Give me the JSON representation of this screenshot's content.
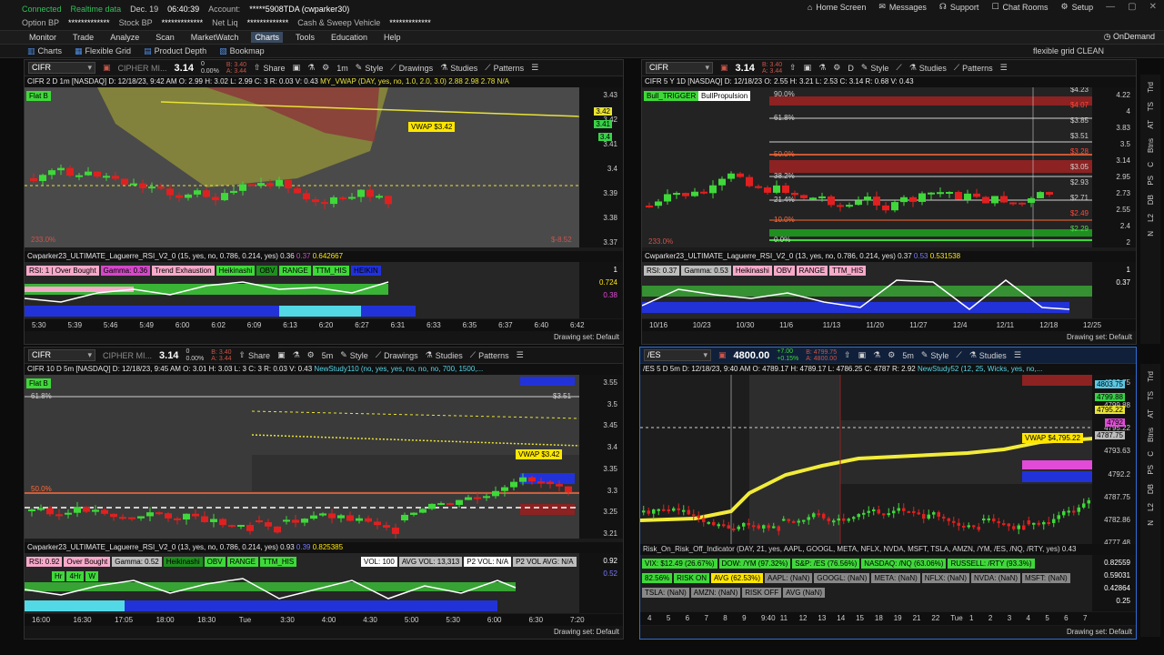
{
  "status": {
    "connected": "Connected",
    "realtime": "Realtime data",
    "date": "Dec. 19",
    "time": "06:40:39",
    "account_label": "Account:",
    "account_value": "*****5908TDA (cwparker30)",
    "option_bp_label": "Option BP",
    "option_bp_value": "*************",
    "stock_bp_label": "Stock BP",
    "stock_bp_value": "*************",
    "net_liq_label": "Net Liq",
    "net_liq_value": "*************",
    "cash_label": "Cash & Sweep Vehicle",
    "cash_value": "*************"
  },
  "topright": {
    "home": "Home Screen",
    "messages": "Messages",
    "support": "Support",
    "chat": "Chat Rooms",
    "setup": "Setup"
  },
  "menu": [
    "Monitor",
    "Trade",
    "Analyze",
    "Scan",
    "MarketWatch",
    "Charts",
    "Tools",
    "Education",
    "Help"
  ],
  "menu_active": "Charts",
  "ondemand": "OnDemand",
  "chartbar": [
    "Charts",
    "Flexible Grid",
    "Product Depth",
    "Bookmap"
  ],
  "grid_name": "flexible grid CLEAN",
  "panels": {
    "tl": {
      "symbol": "CIFR",
      "name": "CIPHER MI...",
      "price": "3.14",
      "change": "0",
      "pct": "0.00%",
      "bid": "B: 3.40",
      "ask": "A: 3.44",
      "share": "Share",
      "period": "1m",
      "style": "Style",
      "drawings": "Drawings",
      "studies": "Studies",
      "patterns": "Patterns",
      "header": "CIFR 2 D 1m [NASDAQ]  D: 12/18/23, 9:42 AM  O: 2.99  H: 3.02  L: 2.99  C: 3  R: 0.03  V: 0.43",
      "header_study": "MY_VWAP (DAY, yes, no, 1.0, 2.0, 3.0)",
      "header_vals": "2.88  2.98  2.78  N/A",
      "flag": "Flat B",
      "vwap_label": "VWAP $3.42",
      "axis": [
        "3.43",
        "3.42",
        "3.41",
        "3.4",
        "3.39",
        "3.38",
        "3.37"
      ],
      "tags": [
        {
          "v": "3.42",
          "c": "#e8e336"
        },
        {
          "v": "3.41",
          "c": "#38d347"
        },
        {
          "v": "3.4",
          "c": "#38d347"
        }
      ],
      "corner_left": "233.0%",
      "corner_right": "$-8.52",
      "ind_header": "Cwparker23_ULTIMATE_Laguerre_RSI_V2_0 (15, yes, no, 0.786, 0.214, yes)  0.36",
      "ind_vals": [
        "0.37",
        "0.642667"
      ],
      "badges": [
        {
          "t": "RSI: 1 | Over Bought",
          "c": "#f7a9c9"
        },
        {
          "t": "Gamma: 0.36",
          "c": "#d448c9"
        },
        {
          "t": "Trend Exhaustion",
          "c": "#f7a9c9"
        },
        {
          "t": "Heikinashi",
          "c": "#3fd83a"
        },
        {
          "t": "OBV",
          "c": "#1f8f1f"
        },
        {
          "t": "RANGE",
          "c": "#3fd83a"
        },
        {
          "t": "TTM_HIS",
          "c": "#3fd83a"
        },
        {
          "t": "HEIKIN",
          "c": "#2232d9"
        }
      ],
      "ind_axis": [
        {
          "v": "1",
          "c": "#ffffff"
        },
        {
          "v": "0.724",
          "c": "#ffe600"
        },
        {
          "v": "0.38",
          "c": "#e14bd8"
        }
      ],
      "times": [
        "5:30",
        "5:39",
        "5:46",
        "5:49",
        "6:00",
        "6:02",
        "6:09",
        "6:13",
        "6:20",
        "6:27",
        "6:31",
        "6:33",
        "6:35",
        "6:37",
        "6:40",
        "6:42"
      ],
      "drawing_set": "Drawing set: Default"
    },
    "tr": {
      "symbol": "CIFR",
      "price": "3.14",
      "bid": "B: 3.40",
      "ask": "A: 3.44",
      "period": "D",
      "style": "Style",
      "studies": "Studies",
      "patterns": "Patterns",
      "header": "CIFR 5 Y 1D [NASDAQ]  D: 12/18/23  O: 2.55  H: 3.21  L: 2.53  C: 3.14  R: 0.68  V: 0.43",
      "bull1": "Bull_TRIGGER",
      "bull2": "BullPropulsion",
      "levels": [
        {
          "t": "$4.23",
          "c": "#d0d0d0"
        },
        {
          "t": "$4.07",
          "c": "#ff4a3a"
        },
        {
          "t": "$3.85",
          "c": "#d0d0d0"
        },
        {
          "t": "$3.51",
          "c": "#d0d0d0"
        },
        {
          "t": "$3.28",
          "c": "#ff4a3a"
        },
        {
          "t": "$3.05",
          "c": "#d0d0d0"
        },
        {
          "t": "$2.93",
          "c": "#d0d0d0"
        },
        {
          "t": "$2.71",
          "c": "#d0d0d0"
        },
        {
          "t": "$2.49",
          "c": "#ff4a3a"
        },
        {
          "t": "$2.29",
          "c": "#4cdb4c"
        }
      ],
      "fibs": [
        {
          "t": "90.0%",
          "c": "#d0d0d0"
        },
        {
          "t": "61.8%",
          "c": "#d0d0d0"
        },
        {
          "t": "50.0%",
          "c": "#ff6a3a"
        },
        {
          "t": "38.2%",
          "c": "#d0d0d0"
        },
        {
          "t": "21.4%",
          "c": "#d0d0d0"
        },
        {
          "t": "10.0%",
          "c": "#ff6a3a"
        },
        {
          "t": "0.0%",
          "c": "#d0d0d0"
        }
      ],
      "axis": [
        "4.22",
        "4",
        "3.83",
        "3.5",
        "3.14",
        "2.95",
        "2.73",
        "2.55",
        "2.4",
        "2"
      ],
      "corner_left": "233.0%",
      "ind_header": "Cwparker23_ULTIMATE_Laguerre_RSI_V2_0 (13, yes, no, 0.786, 0.214, yes)  0.37",
      "ind_vals": [
        "0.53",
        "0.531538"
      ],
      "badges": [
        {
          "t": "RSI: 0.37",
          "c": "#bdbdbd"
        },
        {
          "t": "Gamma: 0.53",
          "c": "#bdbdbd"
        },
        {
          "t": "Heikinashi",
          "c": "#f7a9c9"
        },
        {
          "t": "OBV",
          "c": "#f7a9c9"
        },
        {
          "t": "RANGE",
          "c": "#f7a9c9"
        },
        {
          "t": "TTM_HIS",
          "c": "#f7a9c9"
        }
      ],
      "ind_axis": [
        {
          "v": "1",
          "c": "#ffffff"
        },
        {
          "v": "0.37",
          "c": "#ffffff"
        }
      ],
      "times": [
        "10/16",
        "10/23",
        "10/30",
        "11/6",
        "11/13",
        "11/20",
        "11/27",
        "12/4",
        "12/11",
        "12/18",
        "12/25"
      ],
      "drawing_set": "Drawing set: Default"
    },
    "bl": {
      "symbol": "CIFR",
      "name": "CIPHER MI...",
      "price": "3.14",
      "change": "0",
      "pct": "0.00%",
      "bid": "B: 3.40",
      "ask": "A: 3.44",
      "share": "Share",
      "period": "5m",
      "style": "Style",
      "drawings": "Drawings",
      "studies": "Studies",
      "patterns": "Patterns",
      "header": "CIFR 10 D 5m [NASDAQ]  D: 12/18/23, 9:45 AM  O: 3.01  H: 3.03  L: 3  C: 3  R: 0.03  V: 0.43",
      "header_study": "NewStudy110 (no, yes, yes, no, no, no, 700, 1500,...",
      "flag": "Flat B",
      "fib_top": "61.8%",
      "fib_mid": "50.0%",
      "level": "$3.51",
      "vwap_label": "VWAP $3.42",
      "axis": [
        "3.55",
        "3.5",
        "3.45",
        "3.4",
        "3.35",
        "3.3",
        "3.25",
        "3.21"
      ],
      "ind_header": "Cwparker23_ULTIMATE_Laguerre_RSI_V2_0 (13, yes, no, 0.786, 0.214, yes)  0.93",
      "ind_vals": [
        "0.39",
        "0.825385"
      ],
      "badges": [
        {
          "t": "RSI: 0.92",
          "c": "#f7a9c9"
        },
        {
          "t": "Over Bought",
          "c": "#f7a9c9"
        },
        {
          "t": "Gamma: 0.52",
          "c": "#bdbdbd"
        },
        {
          "t": "Heikinashi",
          "c": "#1f8f1f"
        },
        {
          "t": "OBV",
          "c": "#3fd83a"
        },
        {
          "t": "RANGE",
          "c": "#3fd83a"
        },
        {
          "t": "TTM_HIS",
          "c": "#3fd83a"
        }
      ],
      "vol_badges": [
        {
          "t": "VOL: 100",
          "c": "#ffffff"
        },
        {
          "t": "AVG VOL: 13,313",
          "c": "#bdbdbd"
        },
        {
          "t": "P2 VOL: N/A",
          "c": "#ffffff"
        },
        {
          "t": "P2 VOL AVG: N/A",
          "c": "#bdbdbd"
        }
      ],
      "sub_badges": [
        {
          "t": "Hr",
          "c": "#3fd83a"
        },
        {
          "t": "4Hr",
          "c": "#3fd83a"
        },
        {
          "t": "W",
          "c": "#3fd83a"
        }
      ],
      "ind_axis": [
        {
          "v": "0.92",
          "c": "#ffffff"
        },
        {
          "v": "0.52",
          "c": "#7b7bff"
        }
      ],
      "times": [
        "16:00",
        "16:30",
        "17:05",
        "18:00",
        "18:30",
        "Tue",
        "3:30",
        "4:00",
        "4:30",
        "5:00",
        "5:30",
        "6:00",
        "6:30",
        "7:20"
      ],
      "drawing_set": "Drawing set: Default"
    },
    "br": {
      "symbol": "/ES",
      "price": "4800.00",
      "chg_up": "+7.00",
      "chg_pct": "+0.15%",
      "bid": "B: 4799.75",
      "ask": "A: 4800.00",
      "period": "5m",
      "style": "Style",
      "studies": "Studies",
      "header": "/ES 5 D 5m  D: 12/18/23, 9:40 AM  O: 4789.17  H: 4789.17  L: 4786.25  C: 4787  R: 2.92",
      "header_study": "NewStudy52 (12, 25, Wicks, yes, no,...",
      "vwap_label": "VWAP $4,795.22",
      "axis": [
        "4803.75",
        "4799.88",
        "4795.22",
        "4793.63",
        "4792.2",
        "4787.75",
        "4782.86",
        "4777.48"
      ],
      "tags": [
        {
          "v": "4803.75",
          "c": "#5bc9e6"
        },
        {
          "v": "4799.88",
          "c": "#38d347"
        },
        {
          "v": "4795.22",
          "c": "#e8e336"
        },
        {
          "v": "4792",
          "c": "#e14bd8"
        },
        {
          "v": "4787.75",
          "c": "#bcbcbc"
        }
      ],
      "ind_header": "Risk_On_Risk_Off_Indicator (DAY, 21, yes, AAPL, GOOGL, META, NFLX, NVDA, MSFT, TSLA, AMZN, /YM, /ES, /NQ, /RTY, yes)  0.43",
      "row1": [
        {
          "t": "VIX: $12.49 (26.67%)",
          "c": "#3fd83a"
        },
        {
          "t": "DOW: /YM (97.32%)",
          "c": "#3fd83a"
        },
        {
          "t": "S&P: /ES (76.56%)",
          "c": "#3fd83a"
        },
        {
          "t": "NASDAQ: /NQ (63.06%)",
          "c": "#3fd83a"
        },
        {
          "t": "RUSSELL: /RTY (93.3%)",
          "c": "#3fd83a"
        }
      ],
      "row2": [
        {
          "t": "82.56%",
          "c": "#3fd83a"
        },
        {
          "t": "RISK ON",
          "c": "#3fd83a"
        },
        {
          "t": "AVG (62.53%)",
          "c": "#ffe600"
        },
        {
          "t": "AAPL: (NaN)",
          "c": "#888888"
        },
        {
          "t": "GOOGL: (NaN)",
          "c": "#888888"
        },
        {
          "t": "META: (NaN)",
          "c": "#888888"
        },
        {
          "t": "NFLX: (NaN)",
          "c": "#888888"
        },
        {
          "t": "NVDA: (NaN)",
          "c": "#888888"
        },
        {
          "t": "MSFT: (NaN)",
          "c": "#888888"
        }
      ],
      "row3": [
        {
          "t": "TSLA: (NaN)",
          "c": "#888888"
        },
        {
          "t": "AMZN: (NaN)",
          "c": "#888888"
        },
        {
          "t": "RISK OFF",
          "c": "#888888"
        },
        {
          "t": "AVG (NaN)",
          "c": "#888888"
        }
      ],
      "ind_axis": [
        {
          "v": "0.82559",
          "c": "#ffffff"
        },
        {
          "v": "0.59031",
          "c": "#ffffff"
        },
        {
          "v": "0.42864",
          "c": "#ffffff"
        },
        {
          "v": "0.25",
          "c": "#ffffff"
        }
      ],
      "times": [
        "4",
        "5",
        "6",
        "7",
        "8",
        "9",
        "9:40",
        "11",
        "12",
        "13",
        "14",
        "15",
        "18",
        "19",
        "21",
        "22",
        "Tue",
        "1",
        "2",
        "3",
        "4",
        "5",
        "6",
        "7"
      ],
      "drawing_set": "Drawing set: Default"
    }
  },
  "side_tabs": [
    "Trd",
    "TS",
    "AT",
    "Btns",
    "C",
    "PS",
    "DB",
    "L2",
    "N"
  ]
}
